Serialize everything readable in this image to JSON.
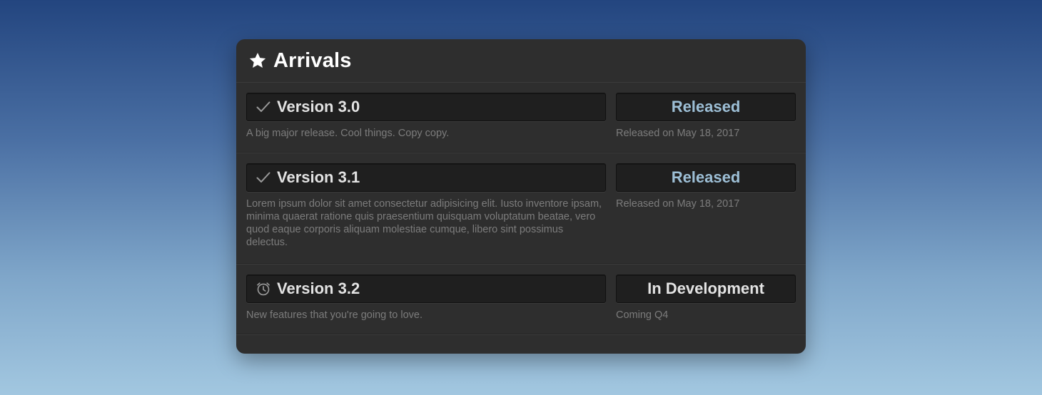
{
  "panel": {
    "title": "Arrivals",
    "icon": "star-icon"
  },
  "rows": [
    {
      "icon": "checkmark-icon",
      "version": "Version 3.0",
      "status": "Released",
      "status_type": "released",
      "description": "A big major release. Cool things. Copy copy.",
      "date_note": "Released on May 18, 2017"
    },
    {
      "icon": "checkmark-icon",
      "version": "Version 3.1",
      "status": "Released",
      "status_type": "released",
      "description": "Lorem ipsum dolor sit amet consectetur adipisicing elit. Iusto inventore ipsam, minima quaerat ratione quis praesentium quisquam voluptatum beatae, vero quod eaque corporis aliquam molestiae cumque, libero sint possimus delectus.",
      "date_note": "Released on May 18, 2017"
    },
    {
      "icon": "alarm-clock-icon",
      "version": "Version 3.2",
      "status": "In Development",
      "status_type": "development",
      "description": "New features that you're going to love.",
      "date_note": "Coming Q4"
    }
  ],
  "colors": {
    "released": "#9dbfd6",
    "development": "#e3e3e3",
    "panel_bg": "#2e2e2e"
  }
}
